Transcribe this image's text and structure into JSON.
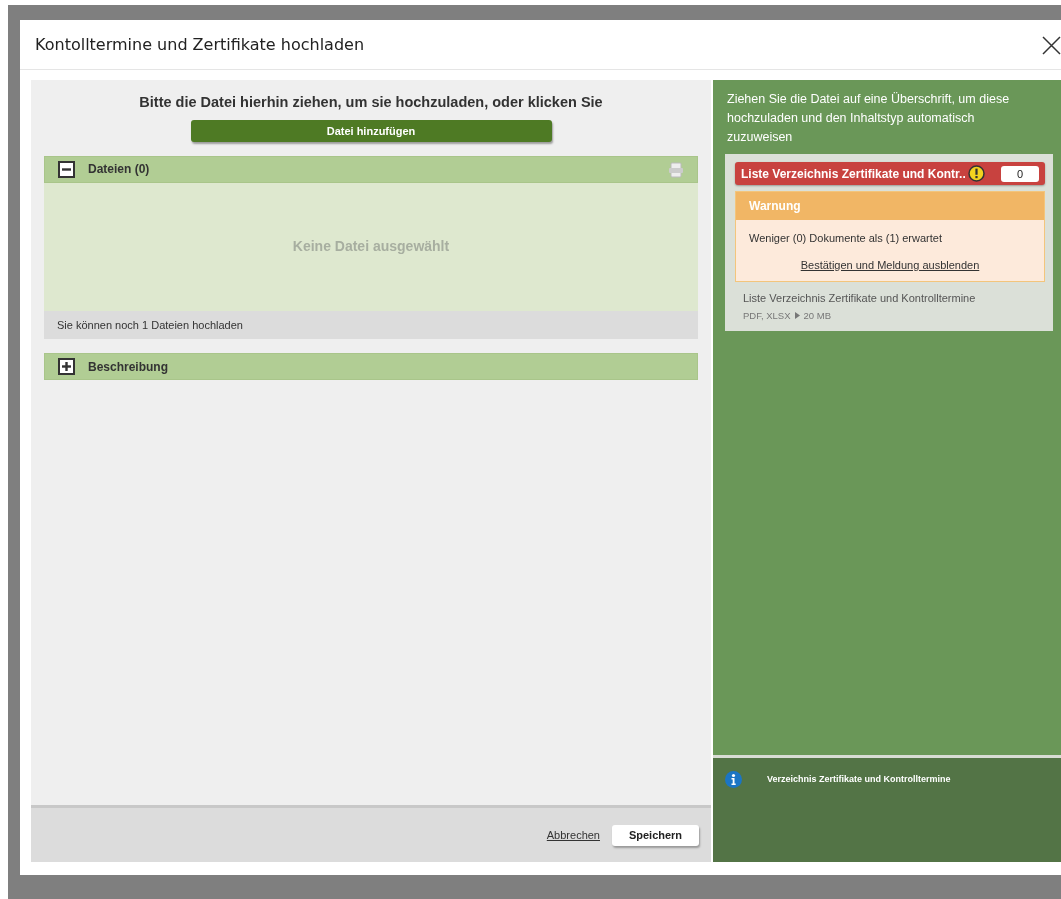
{
  "dialog": {
    "title": "Kontolltermine und Zertifikate hochladen"
  },
  "upload": {
    "instruction": "Bitte die Datei hierhin ziehen, um sie hochzuladen, oder klicken Sie",
    "add_button": "Datei hinzufügen"
  },
  "sections": [
    {
      "kind": "files",
      "title": "Dateien (0)",
      "expanded": true,
      "empty_text": "Keine Datei ausgewählt",
      "footer": "Sie können noch 1 Dateien hochladen"
    },
    {
      "kind": "text",
      "title": "Beschreibung",
      "expanded": false
    }
  ],
  "footer": {
    "cancel": "Abbrechen",
    "save": "Speichern"
  },
  "side": {
    "hint": "Ziehen Sie die Datei auf eine Überschrift, um diese hochzuladen und den Inhaltstyp automatisch zuzuweisen",
    "category": {
      "title": "Liste Verzeichnis Zertifikate und Kontr..",
      "count": "0",
      "warning": true,
      "warning_box": {
        "title": "Warnung",
        "message": "Weniger (0) Dokumente als (1) erwartet",
        "dismiss": "Bestätigen und Meldung ausblenden"
      },
      "description": "Liste Verzeichnis Zertifikate und Kontrolltermine",
      "formats": "PDF, XLSX",
      "size": "20 MB"
    },
    "info": "Verzeichnis Zertifikate und Kontrolltermine"
  }
}
